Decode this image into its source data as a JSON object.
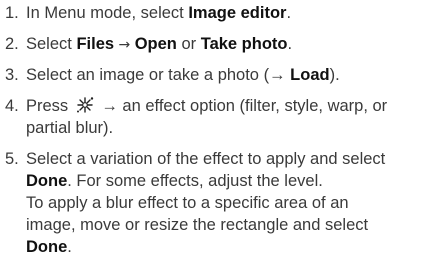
{
  "steps": [
    {
      "number": "1.",
      "pre": "In Menu mode, select ",
      "bold": "Image editor",
      "post": "."
    },
    {
      "number": "2.",
      "pre": "Select ",
      "b1": "Files",
      "arrow": " → ",
      "b2": "Open",
      "mid": " or ",
      "b3": "Take photo",
      "post": "."
    },
    {
      "number": "3.",
      "pre": "Select an image or take a photo (→ ",
      "bold": "Load",
      "post": ")."
    },
    {
      "number": "4.",
      "pre": "Press ",
      "icon": "effects-icon",
      "line1_post": " → an effect option (filter, style, warp, or",
      "line2": "partial blur)."
    },
    {
      "number": "5.",
      "line1": "Select a variation of the effect to apply and select",
      "l2_bold": "Done",
      "l2_post": ". For some effects, adjust the level.",
      "line3": "To apply a blur effect to a specific area of an",
      "line4": "image, move or resize the rectangle and select",
      "l5_bold": "Done",
      "l5_post": "."
    }
  ]
}
